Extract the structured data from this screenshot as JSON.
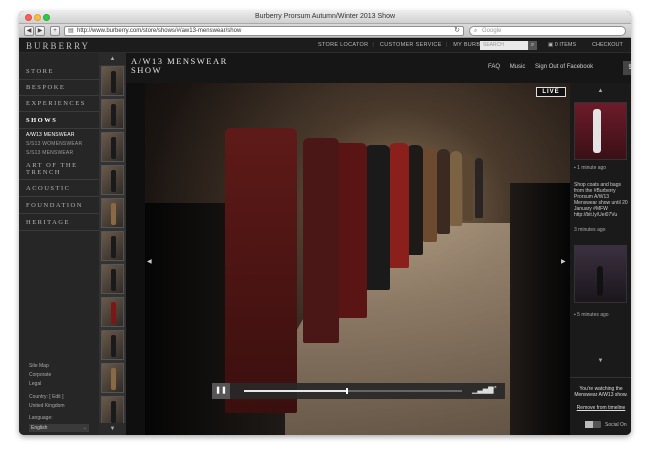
{
  "browser": {
    "title": "Burberry Prorsum Autumn/Winter 2013 Show",
    "url": "http://www.burberry.com/store/shows/#/aw13-menswear/show",
    "search_placeholder": "Google"
  },
  "header": {
    "logo": "BURBERRY",
    "links": [
      "STORE LOCATOR",
      "CUSTOMER SERVICE",
      "MY BURBERRY"
    ],
    "search_placeholder": "SEARCH",
    "bag": "0 ITEMS",
    "checkout": "CHECKOUT"
  },
  "nav": {
    "store": "STORE",
    "bespoke": "BESPOKE",
    "experiences": "EXPERIENCES",
    "shows": "SHOWS",
    "sub": [
      "A/W13 MENSWEAR",
      "S/S13 WOMENSWEAR",
      "S/S13 MENSWEAR"
    ],
    "art_line1": "ART OF THE",
    "art_line2": "TRENCH",
    "acoustic": "ACOUSTIC",
    "foundation": "FOUNDATION",
    "heritage": "HERITAGE",
    "footer": {
      "site_map": "Site Map",
      "corporate": "Corporate",
      "legal": "Legal",
      "country_label": "Country: [ Edit ]",
      "country": "United Kingdom",
      "language_label": "Language:",
      "language": "English"
    }
  },
  "main": {
    "title_line1": "A/W13 MENSWEAR",
    "title_line2": "SHOW",
    "links": [
      "FAQ",
      "Music",
      "Sign Out of Facebook"
    ],
    "live": "LIVE",
    "progress": 0.47
  },
  "timeline": {
    "time1": "1 minute ago",
    "post_text": "Shop coats and bags from the #Burberry Prorsum A/W13 Menswear show until 20 January #MFW http://bit.ly/Uei07Vu",
    "time2": "3 minutes ago",
    "time3": "5 minutes ago",
    "watching": "You're watching the Menswear A/W13 show.",
    "remove": "Remove from timeline",
    "social": "Social On"
  },
  "icons": {
    "back": "back-arrow-icon",
    "forward": "forward-arrow-icon",
    "share": "share-icon",
    "pause": "pause-icon",
    "volume": "volume-icon",
    "fullscreen": "fullscreen-icon"
  },
  "colors": {
    "background": "#111111",
    "accent": "#ffffff"
  }
}
